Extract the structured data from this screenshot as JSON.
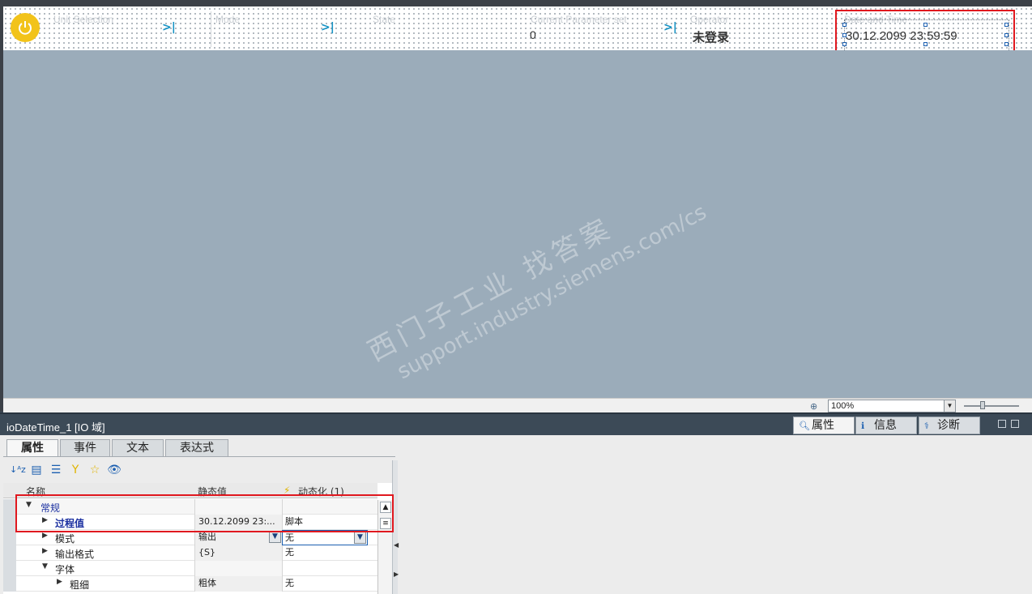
{
  "header": {
    "fields": [
      {
        "label": "Unit Selection",
        "value": ""
      },
      {
        "label": "Mode",
        "value": ""
      },
      {
        "label": "State",
        "value": ""
      },
      {
        "label": "Current Parameter set",
        "value": "0"
      },
      {
        "label": "Operator",
        "value": "未登录"
      },
      {
        "label": "Date and Time",
        "value": "30.12.2099  23:59:59"
      }
    ],
    "jump_icon": ">|"
  },
  "watermark": {
    "line1": "西门子工业  找答案",
    "line2": "support.industry.siemens.com/cs"
  },
  "zoom": {
    "value": "100%"
  },
  "inspector": {
    "title": "ioDateTime_1  [IO 域]",
    "right_tabs": [
      "属性",
      "信息",
      "诊断"
    ],
    "tabs": [
      "属性",
      "事件",
      "文本",
      "表达式"
    ],
    "columns": {
      "name": "名称",
      "static": "静态值",
      "dynamic": "动态化 (1)"
    },
    "rows": [
      {
        "name": "常规",
        "static": "",
        "dynamic": ""
      },
      {
        "name": "过程值",
        "static": "30.12.2099  23:...",
        "dynamic": "脚本"
      },
      {
        "name": "模式",
        "static": "输出",
        "dynamic": "无"
      },
      {
        "name": "输出格式",
        "static": "{S}",
        "dynamic": "无"
      },
      {
        "name": "字体",
        "static": "",
        "dynamic": ""
      },
      {
        "name": "粗细",
        "static": "粗体",
        "dynamic": "无"
      }
    ]
  },
  "colors": {
    "accent": "#1592c4",
    "power": "#f2c31a",
    "highlight": "#e0181f",
    "canvas": "#9bacba"
  }
}
